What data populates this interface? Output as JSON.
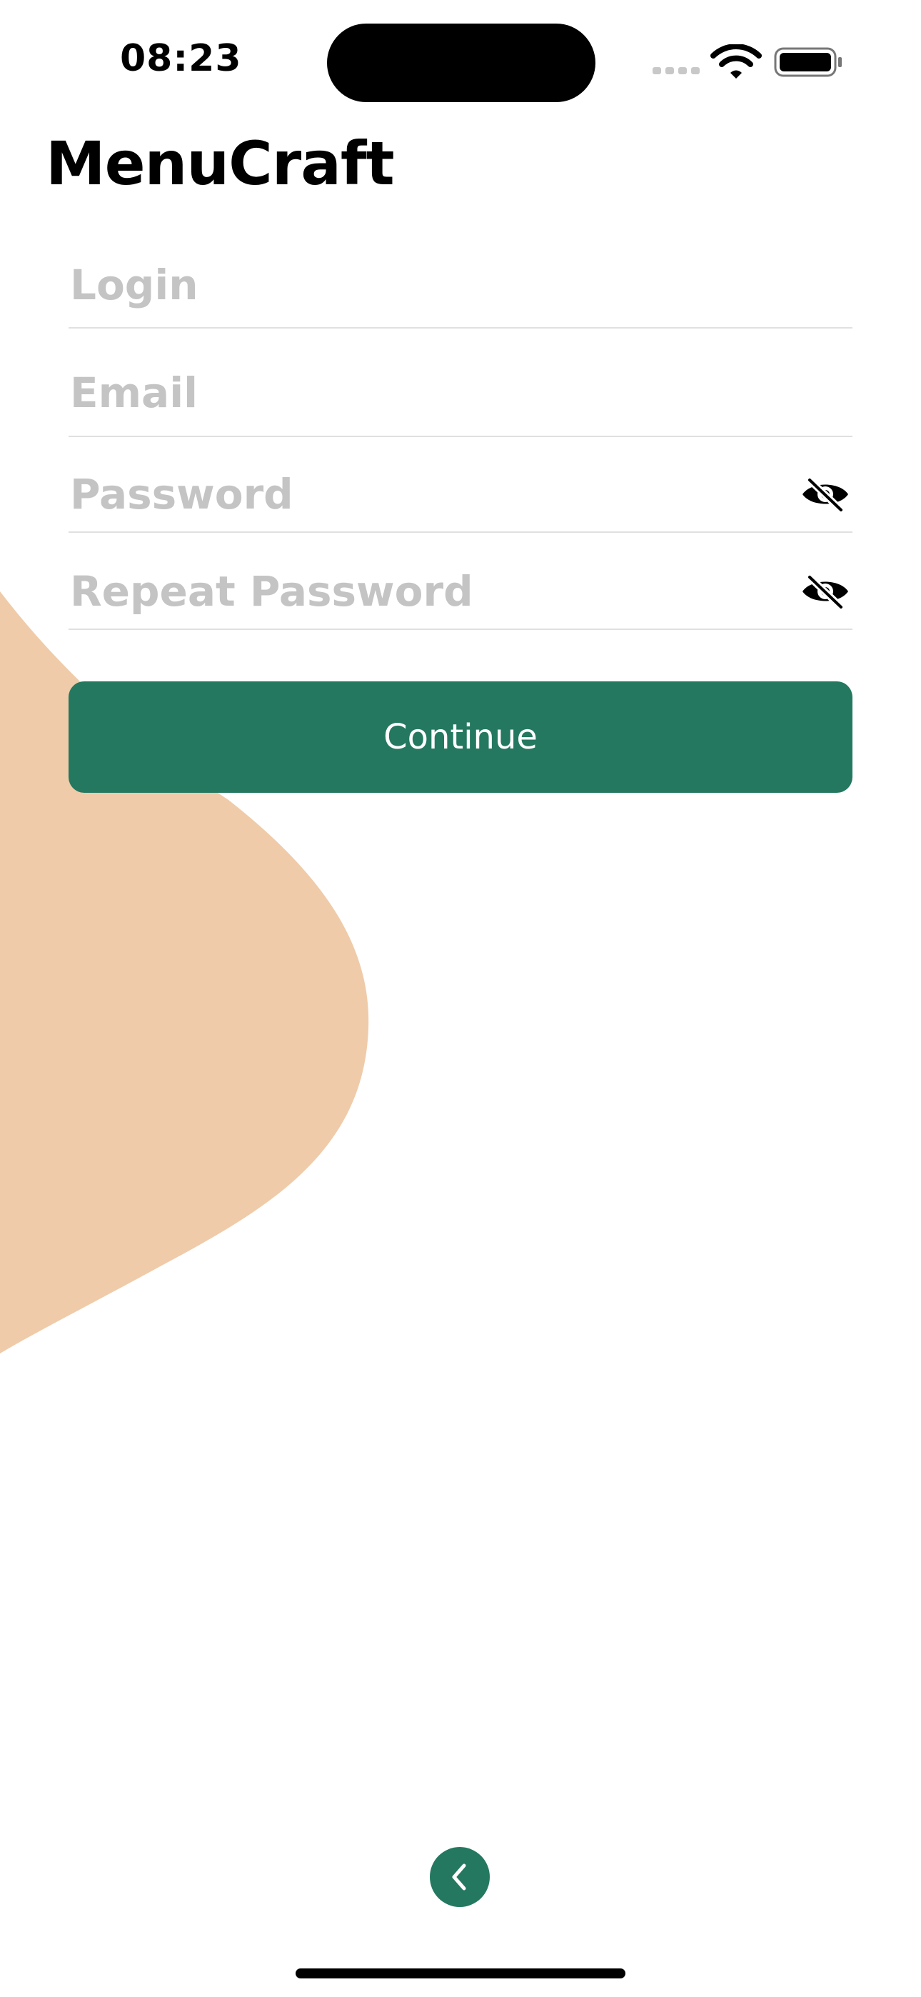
{
  "status_bar": {
    "time": "08:23"
  },
  "app": {
    "title": "MenuCraft"
  },
  "form": {
    "login_placeholder": "Login",
    "email_placeholder": "Email",
    "password_placeholder": "Password",
    "repeat_password_placeholder": "Repeat Password",
    "continue_label": "Continue"
  },
  "icons": {
    "password_toggle": "eye-slash-icon",
    "repeat_password_toggle": "eye-slash-icon",
    "back": "chevron-left-icon",
    "status": [
      "cellular-signal-icon",
      "wifi-icon",
      "battery-icon"
    ]
  },
  "colors": {
    "accent": "#247860",
    "blob": "#EFCBA9",
    "placeholder": "#C4C4C4",
    "divider": "#E0E0E0",
    "background": "#FFFFFF"
  }
}
